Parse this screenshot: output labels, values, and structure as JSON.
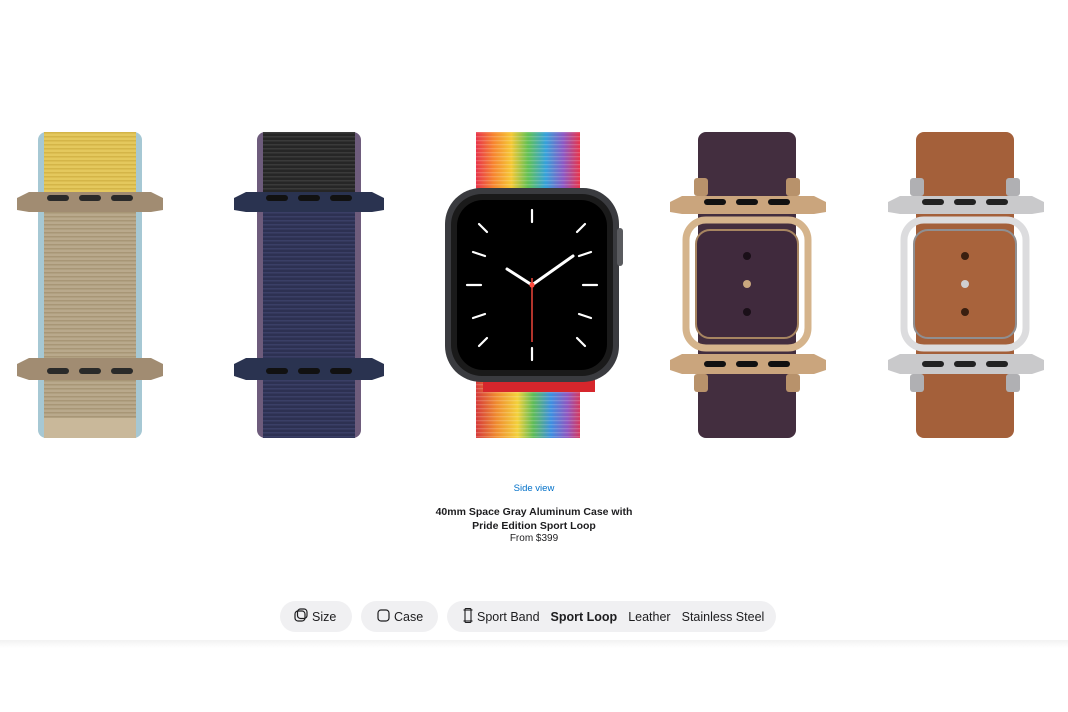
{
  "gallery": {
    "bands": [
      {
        "id": "tan-sport-loop",
        "colors": {
          "top": "#e4c85d",
          "body": "#b9a98c",
          "edge": "#a6c8d4",
          "lug": "#a18c72"
        }
      },
      {
        "id": "midnight-blue-sport-loop",
        "colors": {
          "top": "#262626",
          "body": "#2d3152",
          "edge": "#6e5c7c",
          "lug": "#2a3350"
        }
      },
      {
        "id": "pride-edition-sport-loop",
        "colors": {
          "case": "#3a3b3f",
          "hands": "#ffffff",
          "second_hand": "#ff4b3e"
        }
      },
      {
        "id": "deep-violet-modern-buckle",
        "colors": {
          "leather": "#3c2638",
          "metal": "#caa57d"
        }
      },
      {
        "id": "saddle-brown-modern-buckle",
        "colors": {
          "leather": "#a4603a",
          "metal": "#c9c9cb"
        }
      }
    ],
    "side_view_label": "Side view"
  },
  "product": {
    "title_line1": "40mm Space Gray Aluminum Case with",
    "title_line2": "Pride Edition Sport Loop",
    "price": "From $399"
  },
  "toolbar": {
    "size_label": "Size",
    "case_label": "Case",
    "band_types": [
      "Sport Band",
      "Sport Loop",
      "Leather",
      "Stainless Steel"
    ],
    "selected_band": "Sport Loop"
  },
  "icons": {
    "size": "size-icon",
    "case": "case-icon",
    "band": "band-icon"
  }
}
